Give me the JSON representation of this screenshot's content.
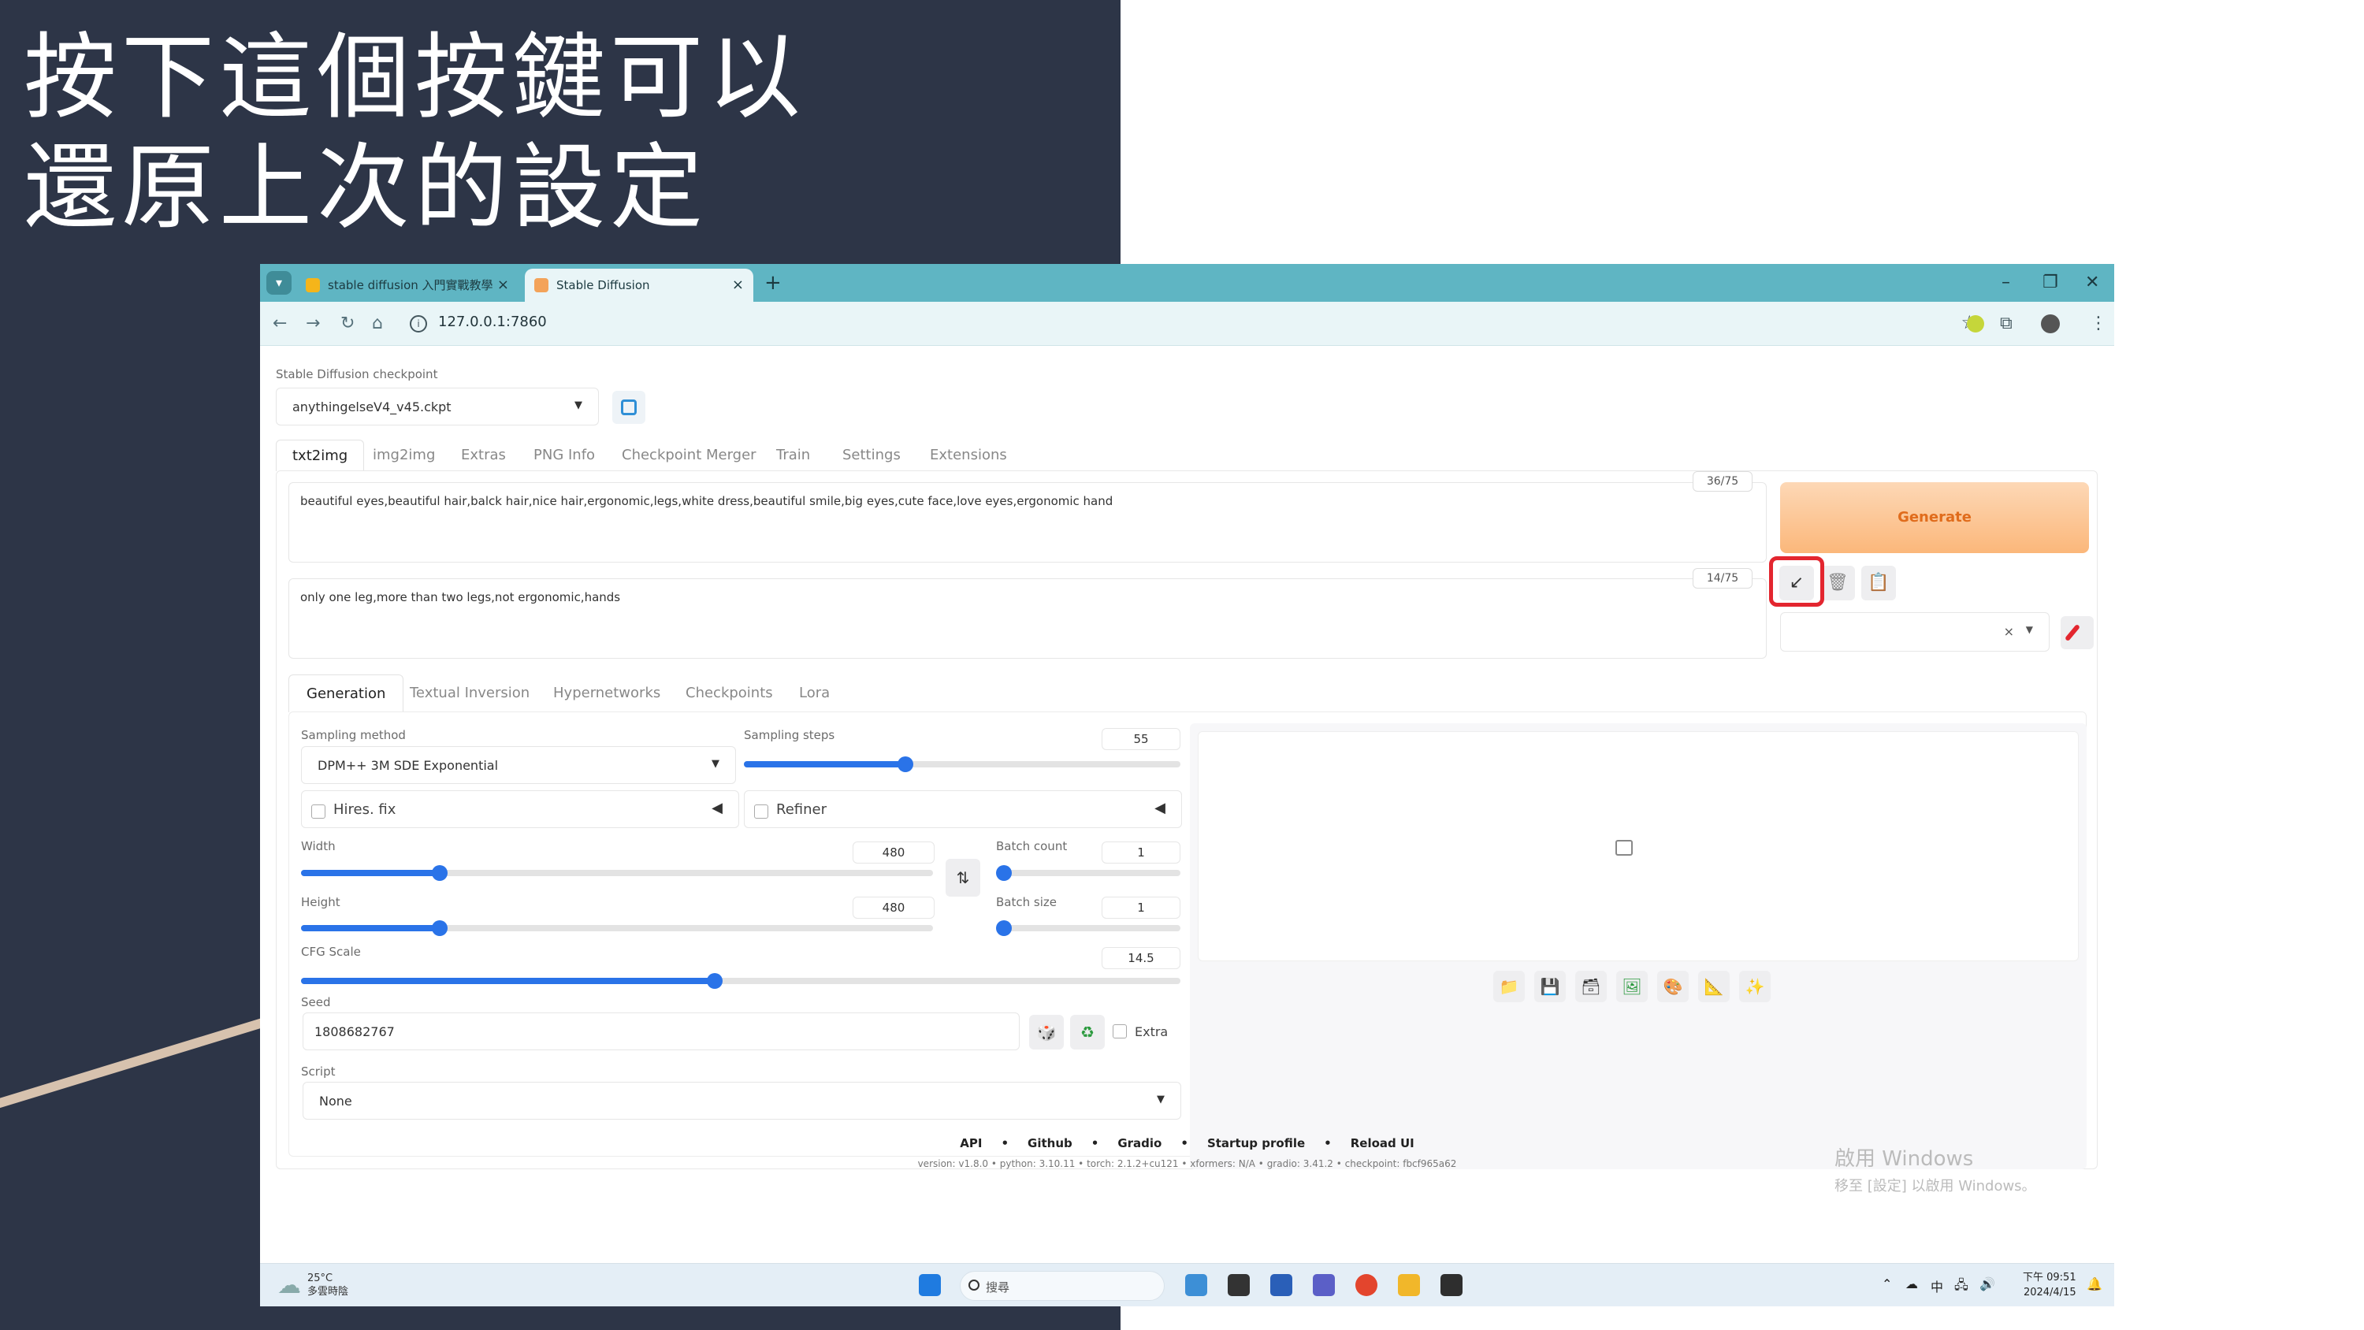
{
  "slide": {
    "headline_line1": "按下這個按鍵可以",
    "headline_line2": "還原上次的設定"
  },
  "browser": {
    "tabs": [
      {
        "label": "stable diffusion 入門實戰教學",
        "favicon_color": "#f5b51a",
        "active": false
      },
      {
        "label": "Stable Diffusion",
        "favicon_color": "#f3a35a",
        "active": true
      }
    ],
    "close_glyph": "×",
    "new_tab_glyph": "+",
    "url": "127.0.0.1:7860"
  },
  "webui": {
    "checkpoint_label": "Stable Diffusion checkpoint",
    "checkpoint_value": "anythingelseV4_v45.ckpt",
    "main_tabs": [
      "txt2img",
      "img2img",
      "Extras",
      "PNG Info",
      "Checkpoint Merger",
      "Train",
      "Settings",
      "Extensions"
    ],
    "prompt": "beautiful eyes,beautiful hair,balck hair,nice hair,ergonomic,legs,white dress,beautiful smile,big eyes,cute face,love eyes,ergonomic hand",
    "prompt_counter": "36/75",
    "negative_prompt": "only one leg,more than two legs,not ergonomic,hands",
    "negative_counter": "14/75",
    "generate_label": "Generate",
    "style_clear": "×",
    "sub_tabs": [
      "Generation",
      "Textual Inversion",
      "Hypernetworks",
      "Checkpoints",
      "Lora"
    ],
    "sampling_method_label": "Sampling method",
    "sampling_method_value": "DPM++ 3M SDE Exponential",
    "sampling_steps_label": "Sampling steps",
    "sampling_steps_value": "55",
    "sampling_steps_fraction": 0.37,
    "hires_label": "Hires. fix",
    "refiner_label": "Refiner",
    "width_label": "Width",
    "width_value": "480",
    "width_fraction": 0.22,
    "height_label": "Height",
    "height_value": "480",
    "height_fraction": 0.22,
    "batch_count_label": "Batch count",
    "batch_count_value": "1",
    "batch_size_label": "Batch size",
    "batch_size_value": "1",
    "cfg_label": "CFG Scale",
    "cfg_value": "14.5",
    "cfg_fraction": 0.47,
    "seed_label": "Seed",
    "seed_value": "1808682767",
    "extra_label": "Extra",
    "script_label": "Script",
    "script_value": "None",
    "footer_links": [
      "API",
      "•",
      "Github",
      "•",
      "Gradio",
      "•",
      "Startup profile",
      "•",
      "Reload UI"
    ],
    "version_line": "version: v1.8.0  •  python: 3.10.11  •  torch: 2.1.2+cu121  •  xformers: N/A  •  gradio: 3.41.2  •  checkpoint: fbcf965a62"
  },
  "watermark": {
    "line1": "啟用 Windows",
    "line2": "移至 [設定] 以啟用 Windows。"
  },
  "taskbar": {
    "temperature": "25°C",
    "weather_text": "多雲時陰",
    "search_placeholder": "搜尋",
    "ime": "中",
    "time": "下午 09:51",
    "date": "2024/4/15"
  },
  "colors": {
    "slide_dark": "#2d3547",
    "browser_frame": "#5fb5c3",
    "generate_text": "#e06c1c",
    "highlight_red": "#e3262f",
    "slider_blue": "#2a73e8"
  }
}
